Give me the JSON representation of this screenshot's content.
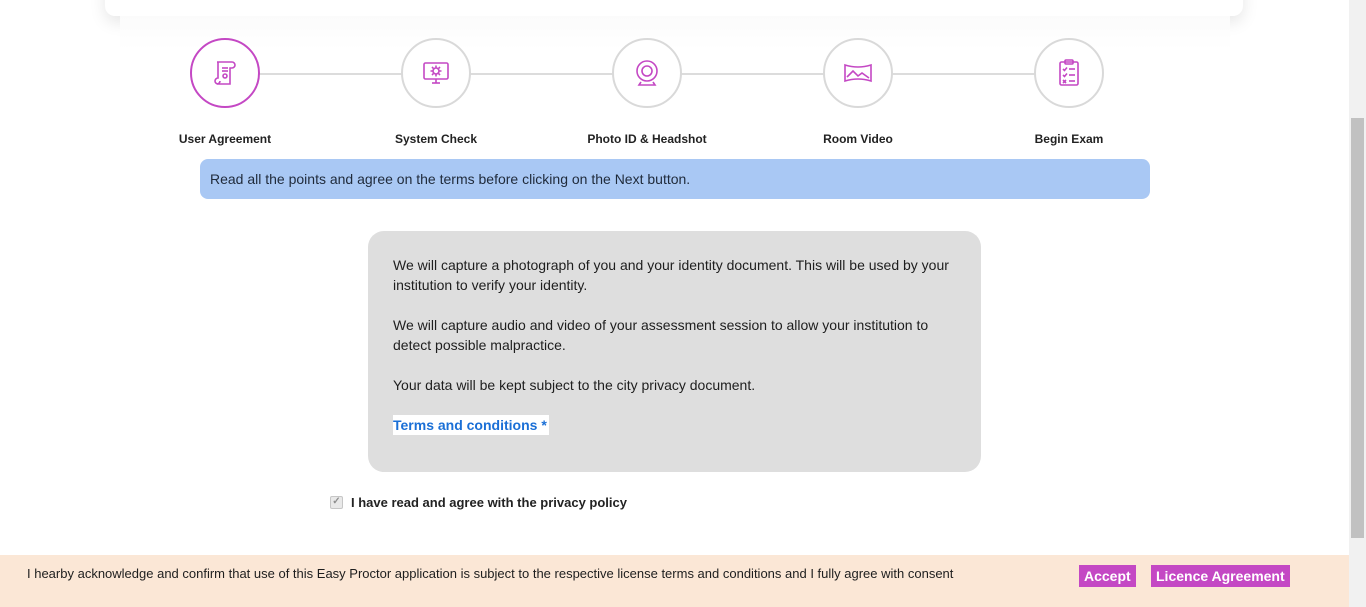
{
  "steps": [
    {
      "label": "User Agreement",
      "icon": "scroll-document-icon",
      "active": true
    },
    {
      "label": "System Check",
      "icon": "monitor-gear-icon",
      "active": false
    },
    {
      "label": "Photo ID & Headshot",
      "icon": "webcam-icon",
      "active": false
    },
    {
      "label": "Room Video",
      "icon": "panorama-image-icon",
      "active": false
    },
    {
      "label": "Begin Exam",
      "icon": "clipboard-checklist-icon",
      "active": false
    }
  ],
  "banner": {
    "text": "Read all the points and agree on the terms before clicking on the Next button."
  },
  "terms": {
    "paragraph1": "We will capture a photograph of you and your identity document. This will be used by your institution to verify your identity.",
    "paragraph2": "We will capture audio and video of your assessment session to allow your institution to detect possible malpractice.",
    "paragraph3": "Your data will be kept subject to the city privacy document.",
    "link": "Terms and conditions *"
  },
  "agree": {
    "label": "I have read and agree with the privacy policy",
    "checked": true
  },
  "consent": {
    "text": "I hearby acknowledge and confirm that use of this Easy Proctor application is subject to the respective license terms and conditions and I fully agree with consent",
    "accept_label": "Accept",
    "licence_label": "Licence Agreement"
  },
  "colors": {
    "accent": "#c448c4",
    "banner": "#a9c8f4",
    "consent_bg": "#fbe7d6",
    "link": "#1a6fd6"
  }
}
